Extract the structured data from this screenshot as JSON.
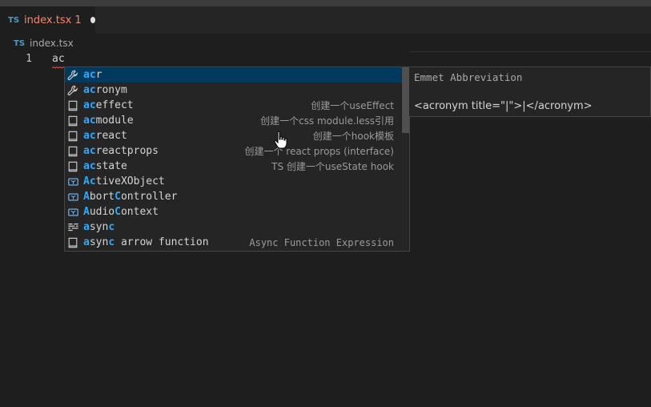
{
  "tab": {
    "badge": "TS",
    "label": "index.tsx 1"
  },
  "breadcrumb": {
    "badge": "TS",
    "label": "index.tsx"
  },
  "editor": {
    "line_number": "1",
    "code": "ac"
  },
  "suggestions": [
    {
      "icon": "wrench-icon",
      "match": "ac",
      "rest": "r",
      "detail": "",
      "selected": true
    },
    {
      "icon": "wrench-icon",
      "match": "ac",
      "rest": "ronym",
      "detail": ""
    },
    {
      "icon": "snippet-icon",
      "match": "ac",
      "rest": "effect",
      "detail": "创建一个useEffect"
    },
    {
      "icon": "snippet-icon",
      "match": "ac",
      "rest": "module",
      "detail": "创建一个css module.less引用"
    },
    {
      "icon": "snippet-icon",
      "match": "ac",
      "rest": "react",
      "detail": "创建一个hook模板"
    },
    {
      "icon": "snippet-icon",
      "match": "ac",
      "rest": "reactprops",
      "detail": "创建一个 react props (interface)"
    },
    {
      "icon": "snippet-icon",
      "match": "ac",
      "rest": "state",
      "detail": "TS 创建一个useState hook"
    },
    {
      "icon": "variable-icon",
      "parts": [
        [
          "A",
          true
        ],
        [
          "c",
          true
        ],
        [
          "tiveXObject",
          false
        ]
      ],
      "detail": ""
    },
    {
      "icon": "variable-icon",
      "parts": [
        [
          "A",
          true
        ],
        [
          "bort",
          false
        ],
        [
          "C",
          true
        ],
        [
          "ontroller",
          false
        ]
      ],
      "detail": ""
    },
    {
      "icon": "variable-icon",
      "parts": [
        [
          "A",
          true
        ],
        [
          "udio",
          false
        ],
        [
          "C",
          true
        ],
        [
          "ontext",
          false
        ]
      ],
      "detail": ""
    },
    {
      "icon": "keyword-icon",
      "parts": [
        [
          "a",
          true
        ],
        [
          "syn",
          false
        ],
        [
          "c",
          true
        ]
      ],
      "detail": ""
    },
    {
      "icon": "snippet-icon",
      "parts": [
        [
          "a",
          true
        ],
        [
          "syn",
          false
        ],
        [
          "c",
          true
        ],
        [
          " arrow function",
          false
        ]
      ],
      "detail": "Async Function Expression"
    }
  ],
  "details": {
    "title": "Emmet Abbreviation",
    "body": "<acronym title=\"|\">|</acronym>"
  },
  "colors": {
    "accent": "#2aaaff",
    "selected": "#04395e",
    "error": "#f48771"
  }
}
